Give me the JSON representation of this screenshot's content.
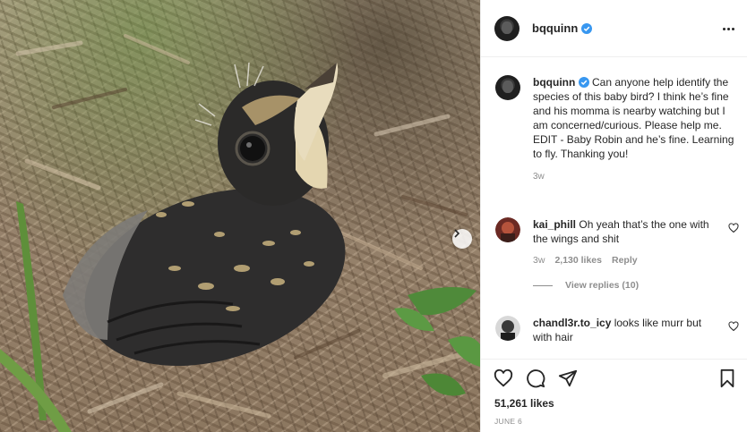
{
  "post": {
    "username": "bqquinn",
    "caption": "Can anyone help identify the species of this baby bird? I think he’s fine and his momma is nearby watching but I am concerned/curious. Please help me. EDIT - Baby Robin and he’s fine. Learning to fly. Thanking you!",
    "caption_time": "3w",
    "likes": "51,261 likes",
    "date": "JUNE 6"
  },
  "comments": [
    {
      "username": "kai_phill",
      "text": "Oh yeah that’s the one with the wings and shit",
      "time": "3w",
      "likes": "2,130 likes",
      "reply_label": "Reply",
      "view_replies": "View replies (10)"
    },
    {
      "username": "chandl3r.to_icy",
      "text": "looks like murr but with hair"
    }
  ],
  "icons": {
    "verified": "verified-badge-icon",
    "more": "more-options-icon",
    "like": "heart-icon",
    "comment": "comment-icon",
    "share": "paper-plane-icon",
    "save": "bookmark-icon",
    "carousel_next": "chevron-right-icon"
  },
  "colors": {
    "verified": "#3897f0",
    "text": "#262626",
    "secondary_text": "#8e8e8e",
    "divider": "#efefef"
  }
}
